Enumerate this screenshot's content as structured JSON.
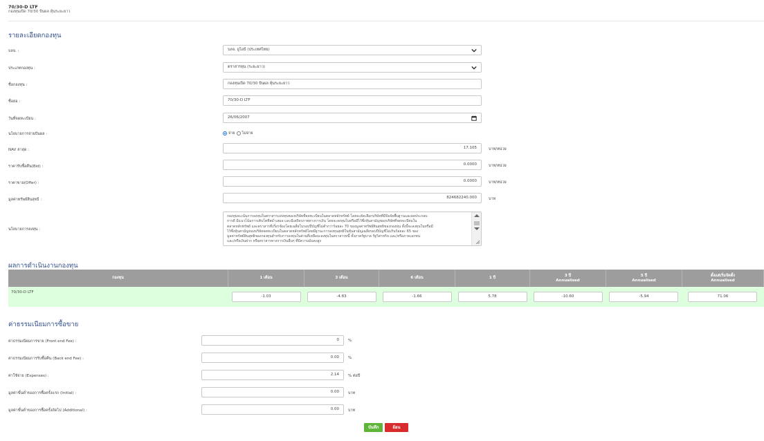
{
  "header": {
    "fund_code": "70/30-D LTF",
    "fund_name": "กองทุนเปิด 70/30 ปันผล หุ้นระยะยาว"
  },
  "details": {
    "title": "รายละเอียดกองทุน",
    "amc": {
      "label": "บลจ. :",
      "value": "บลจ. ยูโอบี (ประเทศไทย)"
    },
    "fund_type": {
      "label": "ประเภทกองทุน :",
      "value": "ตราสารทุน (ระยะยาว)"
    },
    "fund_name": {
      "label": "ชื่อกองทุน :",
      "value": "กองทุนเปิด 70/30 ปันผล หุ้นระยะยาว"
    },
    "abbr": {
      "label": "ชื่อย่อ :",
      "value": "70/30-D LTF"
    },
    "reg_date": {
      "label": "วันที่จดทะเบียน :",
      "value": "26/06/2007"
    },
    "dividend": {
      "label": "นโยบายการจ่ายปันผล :",
      "options": [
        "จ่าย",
        "ไม่จ่าย"
      ],
      "selected": "จ่าย"
    },
    "nav": {
      "label": "NAV ล่าสุด :",
      "value": "17.105",
      "unit": "บาท/หน่วย"
    },
    "bid": {
      "label": "ราคารับซื้อคืน(Bid) :",
      "value": "0.0000",
      "unit": "บาท/หน่วย"
    },
    "offer": {
      "label": "ราคาขาย(Offer) :",
      "value": "0.0000",
      "unit": "บาท/หน่วย"
    },
    "net_asset": {
      "label": "มูลค่าทรัพย์สินสุทธิ :",
      "value": "824682240.000",
      "unit": "บาท"
    },
    "policy": {
      "label": "นโยบายการลงทุน :",
      "lines": [
        "กองทุนจะเน้นการลงทุนในตราสารแห่งทุนของบริษัทที่จดทะเบียนในตลาดหลักทรัพย์ โดยจะคัดเลือกบริษัทที่มีปัจจัยพื้นฐานและผลประกอบ",
        "การดี มีแนวโน้มการเติบโตที่สม่ำเสมอ และมีเสถียรภาพทางการเงิน โดยจะลงทุนในหรือมีไว้ซึ่งหุ้นสามัญของบริษัทที่จดทะเบียนใน",
        "ตลาดหลักทรัพย์ และตราสารที่เกี่ยวข้องโดยเฉลี่ยในรอบปีบัญชีไม่ต่ำกว่าร้อยละ 70 ของมูลค่าทรัพย์สินสุทธิของกองทุน ทั้งนี้จะลงทุนในหรือมี",
        "ไว้ซึ่งหุ้นสามัญของบริษัทจดทะเบียนในตลาดหลักทรัพย์โดยมีฐานะการลงทุนสุทธิในหุ้นสามัญเฉลี่ยรอบปีบัญชีไม่เกินร้อยละ 65 ของ",
        "มูลค่าทรัพย์สินสุทธิของกองทุนสำหรับการลงทุนในส่วนที่เหลือจะลงทุนในตราสารหนี้ ทั้งภาครัฐบาล รัฐวิสาหกิจ และ/หรือภาคเอกชน",
        "และ/หรือเงินฝาก หรือตราสารทางการเงินอื่นๆ ที่มีความมั่นคงสูง"
      ]
    }
  },
  "performance": {
    "title": "ผลการดำเนินงานกองทุน",
    "headers": [
      [
        "กองทุน"
      ],
      [
        "1 เดือน"
      ],
      [
        "3 เดือน"
      ],
      [
        "6 เดือน"
      ],
      [
        "1 ปี"
      ],
      [
        "3 ปี",
        "Annualised"
      ],
      [
        "5 ปี",
        "Annualised"
      ],
      [
        "ตั้งแต่เริ่มจัดตั้ง",
        "Annualised"
      ]
    ],
    "row": {
      "fund": "70/30-D LTF",
      "values": [
        "-1.03",
        "-4.83",
        "-1.66",
        "5.78",
        "-10.60",
        "-5.94",
        "71.06"
      ]
    }
  },
  "fees": {
    "title": "ค่าธรรมเนียมการซื้อขาย",
    "items": [
      {
        "label": "ค่าธรรมเนียมการขาย (Front end Fee) :",
        "value": "0",
        "unit": "%"
      },
      {
        "label": "ค่าธรรมเนียมการรับซื้อคืน (Back end Fee) :",
        "value": "0.00",
        "unit": "%"
      },
      {
        "label": "ค่าใช้จ่าย (Expenses) :",
        "value": "2.14",
        "unit": "% ต่อปี"
      },
      {
        "label": "มูลค่าขั้นต่ำของการซื้อครั้งแรก (Initial) :",
        "value": "0.00",
        "unit": "บาท"
      },
      {
        "label": "มูลค่าขั้นต่ำของการซื้อครั้งถัดไป (Additional) :",
        "value": "0.00",
        "unit": "บาท"
      }
    ]
  },
  "buttons": {
    "save": "บันทึก",
    "back": "ย้อนกลับ"
  },
  "colors": {
    "section_title": "#33508a",
    "table_header": "#9d9d9d",
    "table_row": "#ddffdd",
    "save": "#5fb538",
    "back": "#d92b2b"
  }
}
